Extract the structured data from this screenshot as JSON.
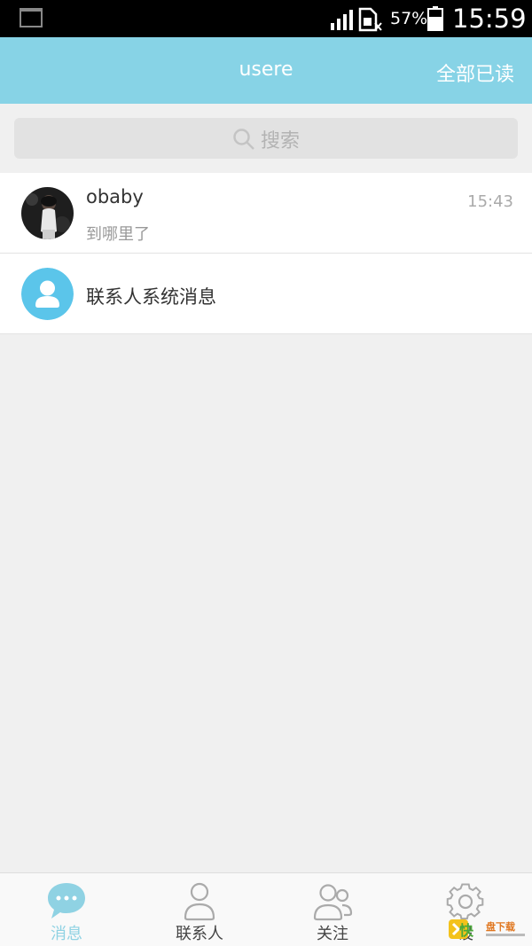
{
  "status_bar": {
    "battery_percent": "57%",
    "time": "15:59"
  },
  "header": {
    "title": "usere",
    "mark_all_read": "全部已读"
  },
  "search": {
    "placeholder": "搜索"
  },
  "conversations": [
    {
      "name": "obaby",
      "last_message": "到哪里了",
      "time": "15:43"
    },
    {
      "name": "联系人系统消息"
    }
  ],
  "nav": {
    "items": [
      {
        "label": "消息",
        "icon": "chat-bubble-icon",
        "active": true
      },
      {
        "label": "联系人",
        "icon": "person-icon",
        "active": false
      },
      {
        "label": "关注",
        "icon": "people-icon",
        "active": false
      },
      {
        "label": "设",
        "icon": "gear-icon",
        "active": false
      }
    ]
  },
  "watermark": {
    "brand": "快盘下载"
  },
  "colors": {
    "header_bg": "#87d3e6",
    "accent": "#5bc5ea",
    "active_tab": "#8fd2e3"
  }
}
